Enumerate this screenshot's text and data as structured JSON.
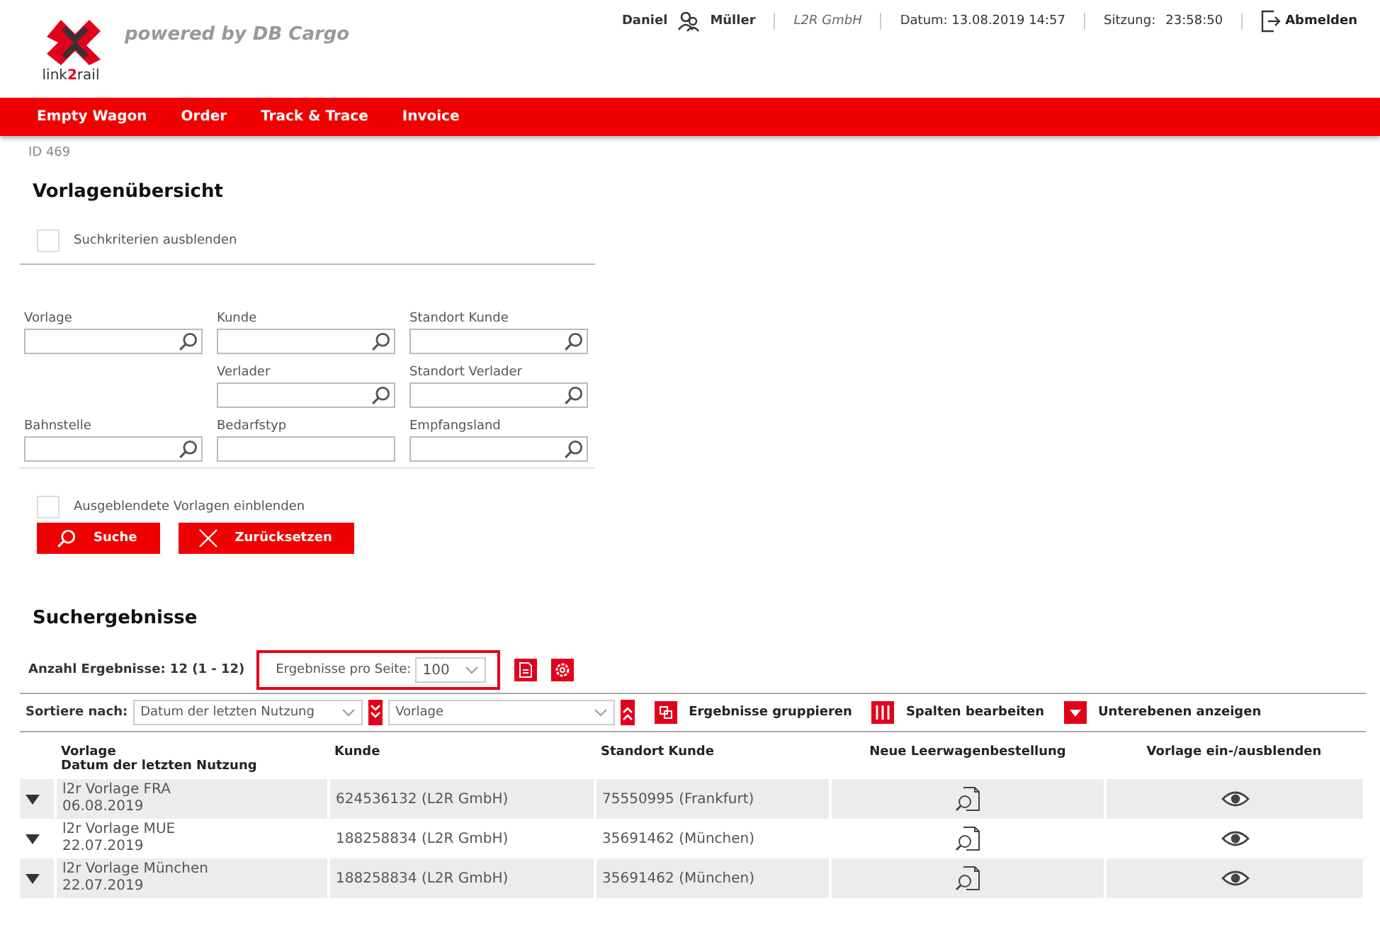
{
  "header": {
    "logo_text": {
      "before": "link",
      "accent": "2",
      "after": "rail"
    },
    "tagline": "powered by DB Cargo",
    "user_first": "Daniel",
    "user_last": "Müller",
    "company": "L2R GmbH",
    "date": "Datum: 13.08.2019 14:57",
    "session_label": "Sitzung:",
    "session_time": "23:58:50",
    "logout": "Abmelden"
  },
  "nav": [
    {
      "label": "Empty Wagon"
    },
    {
      "label": "Order"
    },
    {
      "label": "Track & Trace"
    },
    {
      "label": "Invoice"
    }
  ],
  "page_id": "ID 469",
  "title": "Vorlagenübersicht",
  "hide_criteria": {
    "label": "Suchkriterien ausblenden",
    "checked": false
  },
  "fields": [
    {
      "label": "Vorlage",
      "kind": "search"
    },
    {
      "label": "Kunde",
      "kind": "search"
    },
    {
      "label": "Standort Kunde",
      "kind": "search"
    },
    {
      "label": "Verlader",
      "kind": "search"
    },
    {
      "label": "Standort Verlader",
      "kind": "search"
    },
    {
      "label": "Bahnstelle",
      "kind": "search"
    },
    {
      "label": "Bedarfstyp",
      "kind": "text"
    },
    {
      "label": "Empfangsland",
      "kind": "search"
    }
  ],
  "show_hidden": {
    "label": "Ausgeblendete Vorlagen einblenden",
    "checked": false
  },
  "buttons": [
    {
      "label": "Suche",
      "kind": "search"
    },
    {
      "label": "Zurücksetzen",
      "kind": "reset"
    }
  ],
  "results_title": "Suchergebnisse",
  "result_count": "Anzahl Ergebnisse: 12 (1 - 12)",
  "per_page": {
    "label": "Ergebnisse pro Seite:",
    "value": "100"
  },
  "sort": {
    "label": "Sortiere nach:",
    "first": "Datum der letzten Nutzung",
    "second": "Vorlage"
  },
  "actions": [
    {
      "label": "Ergebnisse gruppieren",
      "kind": "group"
    },
    {
      "label": "Spalten bearbeiten",
      "kind": "columns"
    },
    {
      "label": "Unterebenen anzeigen",
      "kind": "expand"
    }
  ],
  "table": {
    "columns": [
      {
        "lines": [
          "Vorlage",
          "Datum der letzten Nutzung"
        ]
      },
      {
        "lines": [
          "Kunde"
        ]
      },
      {
        "lines": [
          "Standort Kunde"
        ]
      },
      {
        "lines": [
          "Neue Leerwagenbestellung"
        ]
      },
      {
        "lines": [
          "Vorlage ein-/ausblenden"
        ]
      }
    ],
    "rows": [
      {
        "name": "l2r Vorlage FRA",
        "date": "06.08.2019",
        "kunde": "624536132 (L2R GmbH)",
        "standort": "75550995 (Frankfurt)"
      },
      {
        "name": "l2r Vorlage MUE",
        "date": "22.07.2019",
        "kunde": "188258834 (L2R GmbH)",
        "standort": "35691462 (München)"
      },
      {
        "name": "l2r Vorlage München",
        "date": "22.07.2019",
        "kunde": "188258834 (L2R GmbH)",
        "standort": "35691462 (München)"
      }
    ]
  }
}
